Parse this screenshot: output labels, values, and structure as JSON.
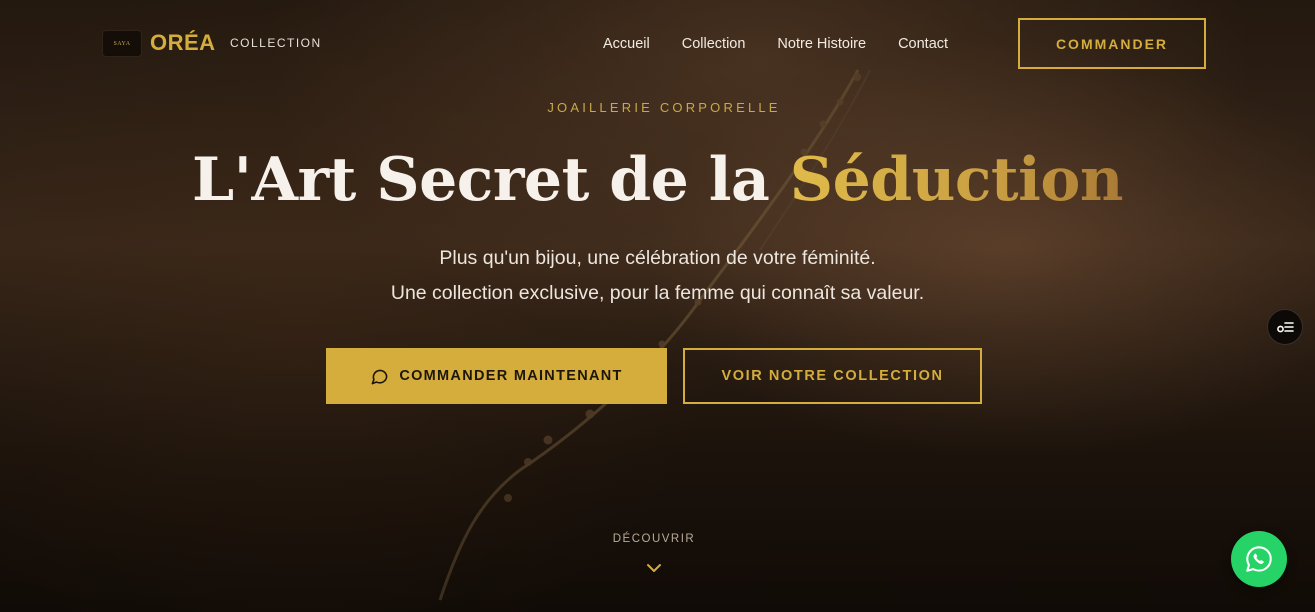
{
  "brand": {
    "badge_text": "SAYA",
    "name": "ORÉA",
    "subtitle": "COLLECTION"
  },
  "nav": {
    "links": [
      "Accueil",
      "Collection",
      "Notre Histoire",
      "Contact"
    ],
    "cta_label": "COMMANDER"
  },
  "hero": {
    "eyebrow": "JOAILLERIE CORPORELLE",
    "headline_main": "L'Art Secret de la ",
    "headline_accent": "Séduction",
    "subtitle_line1": "Plus qu'un bijou, une célébration de votre féminité.",
    "subtitle_line2": "Une collection exclusive, pour la femme qui connaît sa valeur.",
    "primary_button": "COMMANDER MAINTENANT",
    "secondary_button": "VOIR NOTRE COLLECTION",
    "discover_label": "DÉCOUVRIR"
  },
  "icons": {
    "primary_button_icon": "chat-bubble-icon",
    "discover_icon": "chevron-down-icon",
    "floating_control_icon": "settings-toggle-icon",
    "whatsapp_icon": "whatsapp-icon"
  },
  "colors": {
    "gold": "#d4ad3d",
    "dark_bg": "#1d130b",
    "whatsapp_green": "#25d366"
  }
}
